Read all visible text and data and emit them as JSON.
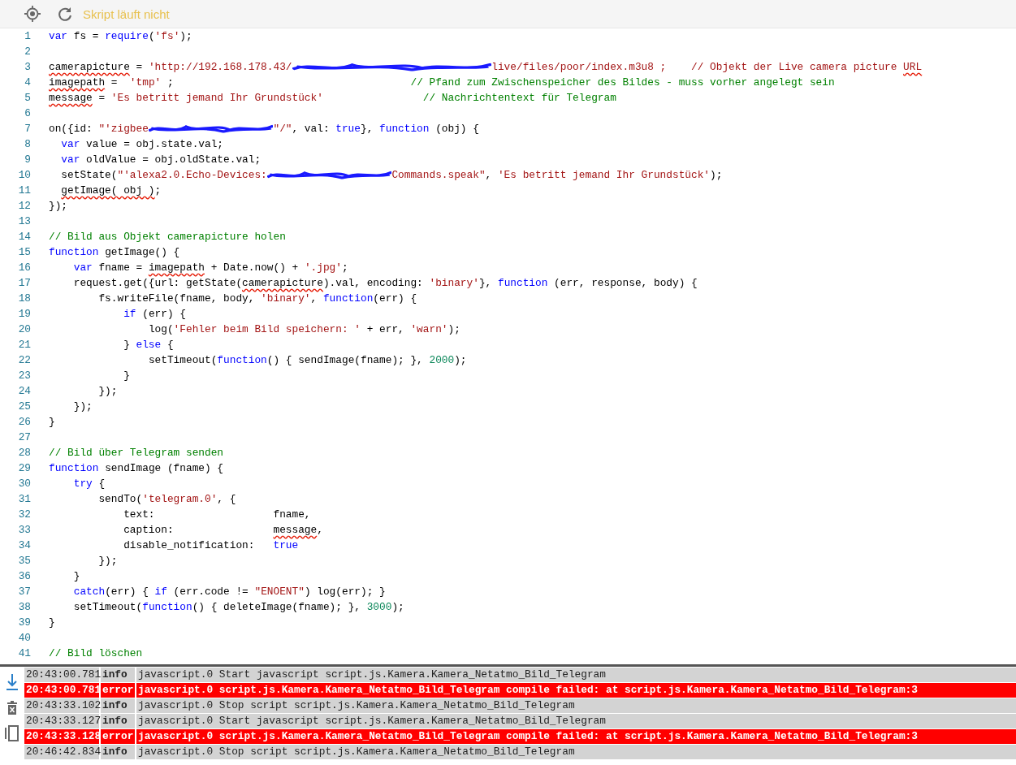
{
  "toolbar": {
    "status": "Skript läuft nicht"
  },
  "editor": {
    "lines": [
      {
        "number": "1",
        "tokens": [
          {
            "kind": "kw",
            "t": "var"
          },
          {
            "kind": "plain",
            "t": " fs = "
          },
          {
            "kind": "kw",
            "t": "require"
          },
          {
            "kind": "plain",
            "t": "("
          },
          {
            "kind": "str",
            "t": "'fs'"
          },
          {
            "kind": "plain",
            "t": ");"
          }
        ]
      },
      {
        "number": "2"
      },
      {
        "number": "3",
        "tokens": [
          {
            "kind": "plain",
            "t": "camerapicture",
            "err": true
          },
          {
            "kind": "plain",
            "t": " = "
          },
          {
            "kind": "str",
            "t": "'http://192.168.178.43/"
          },
          {
            "kind": "redaction-long"
          },
          {
            "kind": "str",
            "t": "live/files/poor/index.m3u8 ;    // Objekt der Live camera picture "
          },
          {
            "kind": "str",
            "t": "URL",
            "err": true
          }
        ]
      },
      {
        "number": "4",
        "tokens": [
          {
            "kind": "plain",
            "t": "imagepath",
            "err": true
          },
          {
            "kind": "plain",
            "t": " =  "
          },
          {
            "kind": "str",
            "t": "'tmp'"
          },
          {
            "kind": "plain",
            "t": " ;                                      "
          },
          {
            "kind": "com",
            "t": "// Pfand zum Zwischenspeicher des Bildes - muss vorher angelegt sein"
          }
        ]
      },
      {
        "number": "5",
        "tokens": [
          {
            "kind": "plain",
            "t": "message",
            "err": true
          },
          {
            "kind": "plain",
            "t": " = "
          },
          {
            "kind": "str",
            "t": "'Es betritt jemand Ihr Grundstück'"
          },
          {
            "kind": "com",
            "t": "                // Nachrichtentext für Telegram"
          }
        ]
      },
      {
        "number": "6"
      },
      {
        "number": "7",
        "tokens": [
          {
            "kind": "plain",
            "t": "on({id: "
          },
          {
            "kind": "str",
            "t": "\"'zigbee"
          },
          {
            "kind": "redaction-short"
          },
          {
            "kind": "str",
            "t": "\"/\""
          },
          {
            "kind": "plain",
            "t": ", val: "
          },
          {
            "kind": "kw",
            "t": "true"
          },
          {
            "kind": "plain",
            "t": "}, "
          },
          {
            "kind": "kw",
            "t": "function"
          },
          {
            "kind": "plain",
            "t": " (obj) {"
          }
        ]
      },
      {
        "number": "8",
        "tokens": [
          {
            "kind": "kw",
            "t": "  var"
          },
          {
            "kind": "plain",
            "t": " value = obj.state.val;"
          }
        ]
      },
      {
        "number": "9",
        "tokens": [
          {
            "kind": "kw",
            "t": "  var"
          },
          {
            "kind": "plain",
            "t": " oldValue = obj.oldState.val;"
          }
        ]
      },
      {
        "number": "10",
        "tokens": [
          {
            "kind": "plain",
            "t": "  setState("
          },
          {
            "kind": "str",
            "t": "\"'alexa2.0.Echo-Devices:"
          },
          {
            "kind": "redaction-short"
          },
          {
            "kind": "str",
            "t": "Commands.speak\""
          },
          {
            "kind": "plain",
            "t": ", "
          },
          {
            "kind": "str",
            "t": "'Es betritt jemand Ihr Grundstück'"
          },
          {
            "kind": "plain",
            "t": ");"
          }
        ]
      },
      {
        "number": "11",
        "tokens": [
          {
            "kind": "plain",
            "t": "  getImage( obj )",
            "err": true
          },
          {
            "kind": "plain",
            "t": ";"
          }
        ]
      },
      {
        "number": "12",
        "tokens": [
          {
            "kind": "plain",
            "t": "});"
          }
        ]
      },
      {
        "number": "13"
      },
      {
        "number": "14",
        "tokens": [
          {
            "kind": "com",
            "t": "// Bild aus Objekt camerapicture holen"
          }
        ]
      },
      {
        "number": "15",
        "tokens": [
          {
            "kind": "kw",
            "t": "function"
          },
          {
            "kind": "plain",
            "t": " getImage() {"
          }
        ]
      },
      {
        "number": "16",
        "tokens": [
          {
            "kind": "kw",
            "t": "    var"
          },
          {
            "kind": "plain",
            "t": " fname = "
          },
          {
            "kind": "plain",
            "t": "imagepath",
            "err": true
          },
          {
            "kind": "plain",
            "t": " + Date.now() + "
          },
          {
            "kind": "str",
            "t": "'.jpg'"
          },
          {
            "kind": "plain",
            "t": ";"
          }
        ]
      },
      {
        "number": "17",
        "tokens": [
          {
            "kind": "plain",
            "t": "    request.get({url: getState("
          },
          {
            "kind": "plain",
            "t": "camerapicture",
            "err": true
          },
          {
            "kind": "plain",
            "t": ").val, encoding: "
          },
          {
            "kind": "str",
            "t": "'binary'"
          },
          {
            "kind": "plain",
            "t": "}, "
          },
          {
            "kind": "kw",
            "t": "function"
          },
          {
            "kind": "plain",
            "t": " (err, response, body) {"
          }
        ]
      },
      {
        "number": "18",
        "tokens": [
          {
            "kind": "plain",
            "t": "        fs.writeFile(fname, body, "
          },
          {
            "kind": "str",
            "t": "'binary'"
          },
          {
            "kind": "plain",
            "t": ", "
          },
          {
            "kind": "kw",
            "t": "function"
          },
          {
            "kind": "plain",
            "t": "(err) {"
          }
        ]
      },
      {
        "number": "19",
        "tokens": [
          {
            "kind": "kw",
            "t": "            if"
          },
          {
            "kind": "plain",
            "t": " (err) {"
          }
        ]
      },
      {
        "number": "20",
        "tokens": [
          {
            "kind": "plain",
            "t": "                log("
          },
          {
            "kind": "str",
            "t": "'Fehler beim Bild speichern: '"
          },
          {
            "kind": "plain",
            "t": " + err, "
          },
          {
            "kind": "str",
            "t": "'warn'"
          },
          {
            "kind": "plain",
            "t": ");"
          }
        ]
      },
      {
        "number": "21",
        "tokens": [
          {
            "kind": "plain",
            "t": "            } "
          },
          {
            "kind": "kw",
            "t": "else"
          },
          {
            "kind": "plain",
            "t": " {"
          }
        ]
      },
      {
        "number": "22",
        "tokens": [
          {
            "kind": "plain",
            "t": "                setTimeout("
          },
          {
            "kind": "kw",
            "t": "function"
          },
          {
            "kind": "plain",
            "t": "() { sendImage(fname); }, "
          },
          {
            "kind": "num",
            "t": "2000"
          },
          {
            "kind": "plain",
            "t": ");"
          }
        ]
      },
      {
        "number": "23",
        "tokens": [
          {
            "kind": "plain",
            "t": "            }"
          }
        ]
      },
      {
        "number": "24",
        "tokens": [
          {
            "kind": "plain",
            "t": "        });"
          }
        ]
      },
      {
        "number": "25",
        "tokens": [
          {
            "kind": "plain",
            "t": "    });"
          }
        ]
      },
      {
        "number": "26",
        "tokens": [
          {
            "kind": "plain",
            "t": "}"
          }
        ]
      },
      {
        "number": "27"
      },
      {
        "number": "28",
        "tokens": [
          {
            "kind": "com",
            "t": "// Bild über Telegram senden"
          }
        ]
      },
      {
        "number": "29",
        "tokens": [
          {
            "kind": "kw",
            "t": "function"
          },
          {
            "kind": "plain",
            "t": " sendImage (fname) {"
          }
        ]
      },
      {
        "number": "30",
        "tokens": [
          {
            "kind": "kw",
            "t": "    try"
          },
          {
            "kind": "plain",
            "t": " {"
          }
        ]
      },
      {
        "number": "31",
        "tokens": [
          {
            "kind": "plain",
            "t": "        sendTo("
          },
          {
            "kind": "str",
            "t": "'telegram.0'"
          },
          {
            "kind": "plain",
            "t": ", {"
          }
        ]
      },
      {
        "number": "32",
        "tokens": [
          {
            "kind": "plain",
            "t": "            text:                   fname,"
          }
        ]
      },
      {
        "number": "33",
        "tokens": [
          {
            "kind": "plain",
            "t": "            caption:                "
          },
          {
            "kind": "plain",
            "t": "message",
            "err": true
          },
          {
            "kind": "plain",
            "t": ","
          }
        ]
      },
      {
        "number": "34",
        "tokens": [
          {
            "kind": "plain",
            "t": "            disable_notification:   "
          },
          {
            "kind": "kw",
            "t": "true"
          }
        ]
      },
      {
        "number": "35",
        "tokens": [
          {
            "kind": "plain",
            "t": "        });"
          }
        ]
      },
      {
        "number": "36",
        "tokens": [
          {
            "kind": "plain",
            "t": "    }"
          }
        ]
      },
      {
        "number": "37",
        "tokens": [
          {
            "kind": "kw",
            "t": "    catch"
          },
          {
            "kind": "plain",
            "t": "(err) { "
          },
          {
            "kind": "kw",
            "t": "if"
          },
          {
            "kind": "plain",
            "t": " (err.code != "
          },
          {
            "kind": "str",
            "t": "\"ENOENT\""
          },
          {
            "kind": "plain",
            "t": ") log(err); }"
          }
        ]
      },
      {
        "number": "38",
        "tokens": [
          {
            "kind": "plain",
            "t": "    setTimeout("
          },
          {
            "kind": "kw",
            "t": "function"
          },
          {
            "kind": "plain",
            "t": "() { deleteImage(fname); }, "
          },
          {
            "kind": "num",
            "t": "3000"
          },
          {
            "kind": "plain",
            "t": ");"
          }
        ]
      },
      {
        "number": "39",
        "tokens": [
          {
            "kind": "plain",
            "t": "}"
          }
        ]
      },
      {
        "number": "40"
      },
      {
        "number": "41",
        "tokens": [
          {
            "kind": "com",
            "t": "// Bild löschen"
          }
        ]
      }
    ]
  },
  "log": {
    "entries": [
      {
        "time": "20:43:00.781",
        "level": "info",
        "kind": "info",
        "message": "javascript.0 Start javascript script.js.Kamera.Kamera_Netatmo_Bild_Telegram"
      },
      {
        "time": "20:43:00.781",
        "level": "error",
        "kind": "error",
        "message": "javascript.0 script.js.Kamera.Kamera_Netatmo_Bild_Telegram compile failed: at script.js.Kamera.Kamera_Netatmo_Bild_Telegram:3"
      },
      {
        "time": "20:43:33.102",
        "level": "info",
        "kind": "info",
        "message": "javascript.0 Stop script script.js.Kamera.Kamera_Netatmo_Bild_Telegram"
      },
      {
        "time": "20:43:33.127",
        "level": "info",
        "kind": "info",
        "message": "javascript.0 Start javascript script.js.Kamera.Kamera_Netatmo_Bild_Telegram"
      },
      {
        "time": "20:43:33.128",
        "level": "error",
        "kind": "error",
        "message": "javascript.0 script.js.Kamera.Kamera_Netatmo_Bild_Telegram compile failed: at script.js.Kamera.Kamera_Netatmo_Bild_Telegram:3"
      },
      {
        "time": "20:46:42.834",
        "level": "info",
        "kind": "info",
        "message": "javascript.0 Stop script script.js.Kamera.Kamera_Netatmo_Bild_Telegram"
      }
    ]
  }
}
